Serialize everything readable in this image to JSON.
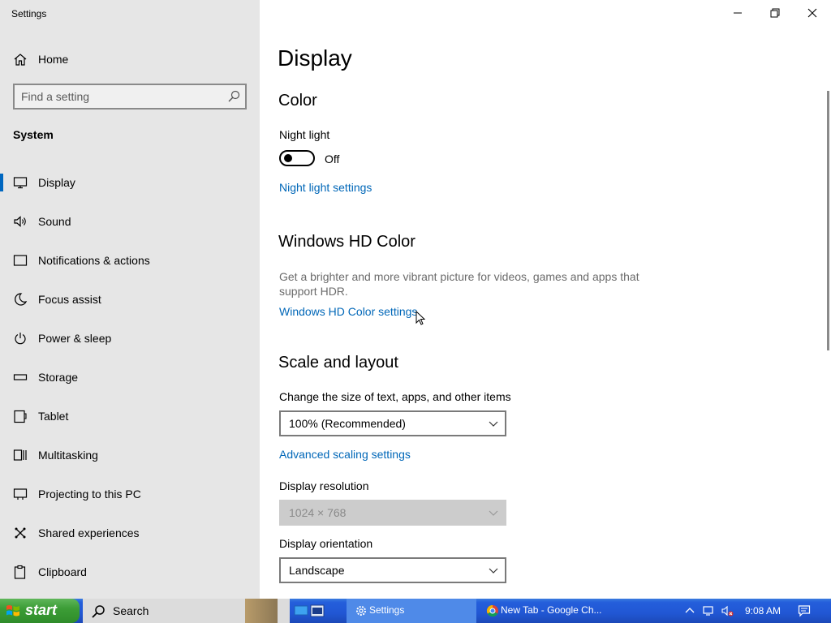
{
  "window": {
    "title": "Settings",
    "controls": [
      "minimize",
      "restore",
      "close"
    ]
  },
  "sidebar": {
    "home_label": "Home",
    "search_placeholder": "Find a setting",
    "section_label": "System",
    "items": [
      {
        "label": "Display",
        "icon": "monitor-icon",
        "selected": true
      },
      {
        "label": "Sound",
        "icon": "speaker-icon"
      },
      {
        "label": "Notifications & actions",
        "icon": "notification-icon"
      },
      {
        "label": "Focus assist",
        "icon": "moon-icon"
      },
      {
        "label": "Power & sleep",
        "icon": "power-icon"
      },
      {
        "label": "Storage",
        "icon": "storage-icon"
      },
      {
        "label": "Tablet",
        "icon": "tablet-icon"
      },
      {
        "label": "Multitasking",
        "icon": "multitasking-icon"
      },
      {
        "label": "Projecting to this PC",
        "icon": "projecting-icon"
      },
      {
        "label": "Shared experiences",
        "icon": "shared-icon"
      },
      {
        "label": "Clipboard",
        "icon": "clipboard-icon"
      }
    ]
  },
  "main": {
    "title": "Display",
    "color": {
      "heading": "Color",
      "night_light_label": "Night light",
      "night_light_state": "Off",
      "night_light_link": "Night light settings"
    },
    "hd_color": {
      "heading": "Windows HD Color",
      "description": "Get a brighter and more vibrant picture for videos, games and apps that support HDR.",
      "link": "Windows HD Color settings"
    },
    "scale": {
      "heading": "Scale and layout",
      "size_label": "Change the size of text, apps, and other items",
      "size_value": "100% (Recommended)",
      "advanced_link": "Advanced scaling settings",
      "resolution_label": "Display resolution",
      "resolution_value": "1024 × 768",
      "orientation_label": "Display orientation",
      "orientation_value": "Landscape"
    }
  },
  "taskbar": {
    "start_label": "start",
    "search_label": "Search",
    "tasks": [
      {
        "label": "Settings",
        "icon": "gear-icon",
        "active": true
      },
      {
        "label": "New Tab - Google Ch...",
        "icon": "chrome-icon",
        "active": false
      }
    ],
    "time": "9:08 AM"
  },
  "colors": {
    "accent": "#0067b8",
    "sidebar_bg": "#e6e6e6",
    "taskbar_blue": "#245edb",
    "start_green": "#3c9d36"
  }
}
